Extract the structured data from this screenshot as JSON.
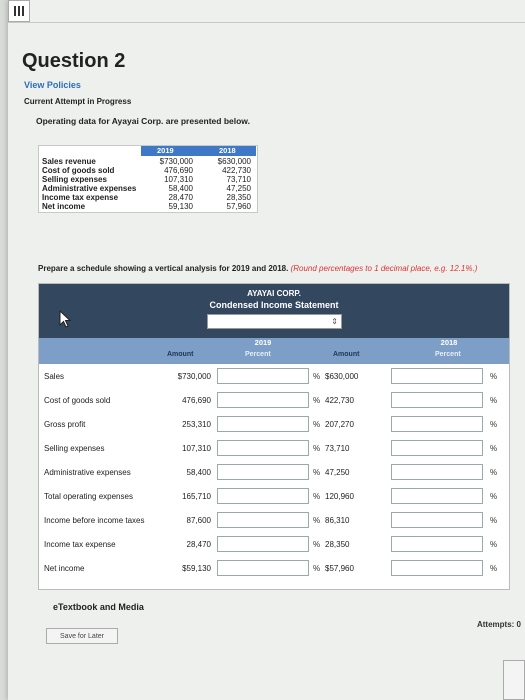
{
  "header": {
    "question_title": "Question 2",
    "view_policies": "View Policies",
    "attempt_status": "Current Attempt in Progress"
  },
  "intro": "Operating data for Ayayai Corp. are presented below.",
  "operating_data": {
    "years": [
      "2019",
      "2018"
    ],
    "rows": [
      {
        "label": "Sales revenue",
        "v2019": "$730,000",
        "v2018": "$630,000"
      },
      {
        "label": "Cost of goods sold",
        "v2019": "476,690",
        "v2018": "422,730"
      },
      {
        "label": "Selling expenses",
        "v2019": "107,310",
        "v2018": "73,710"
      },
      {
        "label": "Administrative expenses",
        "v2019": "58,400",
        "v2018": "47,250"
      },
      {
        "label": "Income tax expense",
        "v2019": "28,470",
        "v2018": "28,350"
      },
      {
        "label": "Net income",
        "v2019": "59,130",
        "v2018": "57,960"
      }
    ]
  },
  "instruction": {
    "main": "Prepare a schedule showing a vertical analysis for 2019 and 2018.",
    "note": "(Round percentages to 1 decimal place, e.g. 12.1%.)"
  },
  "statement": {
    "company": "AYAYAI CORP.",
    "title": "Condensed Income Statement",
    "period_value": "",
    "year_2019": "2019",
    "year_2018": "2018",
    "col_amount": "Amount",
    "col_percent": "Percent",
    "pct_symbol": "%",
    "rows": [
      {
        "label": "Sales",
        "a2019": "$730,000",
        "a2018": "$630,000"
      },
      {
        "label": "Cost of goods sold",
        "a2019": "476,690",
        "a2018": "422,730"
      },
      {
        "label": "Gross profit",
        "a2019": "253,310",
        "a2018": "207,270"
      },
      {
        "label": "Selling expenses",
        "a2019": "107,310",
        "a2018": "73,710"
      },
      {
        "label": "Administrative expenses",
        "a2019": "58,400",
        "a2018": "47,250"
      },
      {
        "label": "Total operating expenses",
        "a2019": "165,710",
        "a2018": "120,960"
      },
      {
        "label": "Income before income taxes",
        "a2019": "87,600",
        "a2018": "86,310"
      },
      {
        "label": "Income tax expense",
        "a2019": "28,470",
        "a2018": "28,350"
      },
      {
        "label": "Net income",
        "a2019": "$59,130",
        "a2018": "$57,960"
      }
    ]
  },
  "footer": {
    "etextbook": "eTextbook and Media",
    "save_later": "Save for Later",
    "attempts": "Attempts: 0"
  },
  "colors": {
    "header_dark": "#33475e",
    "header_band": "#7d9ec6",
    "link_blue": "#2c6fb6",
    "note_red": "#d33333"
  }
}
